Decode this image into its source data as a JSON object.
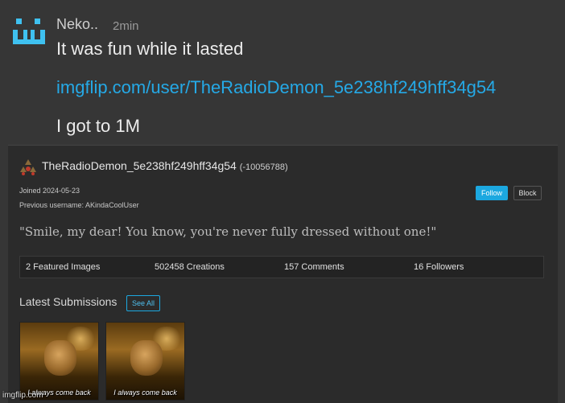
{
  "comment": {
    "username": "Neko..",
    "time": "2min",
    "line1": "It was fun while it lasted",
    "link": "imgflip.com/user/TheRadioDemon_5e238hf249hff34g54",
    "line3": "I got to 1M"
  },
  "profile": {
    "name": "TheRadioDemon_5e238hf249hff34g54",
    "score": "(-10056788)",
    "joined": "Joined 2024-05-23",
    "previous_username": "Previous username: AKindaCoolUser",
    "follow_label": "Follow",
    "block_label": "Block",
    "quote": "\"Smile, my dear! You know, you're never fully dressed without one!\"",
    "stats": {
      "featured": "2 Featured Images",
      "creations": "502458 Creations",
      "comments": "157 Comments",
      "followers": "16 Followers"
    },
    "latest_title": "Latest Submissions",
    "see_all_label": "See All",
    "submissions": [
      {
        "caption": "I always come back"
      },
      {
        "caption": "I always come back"
      }
    ]
  },
  "watermark": "imgflip.com",
  "colors": {
    "accent": "#1ca8e0",
    "link": "#25a9e6",
    "avatar": "#3fc1f0"
  }
}
